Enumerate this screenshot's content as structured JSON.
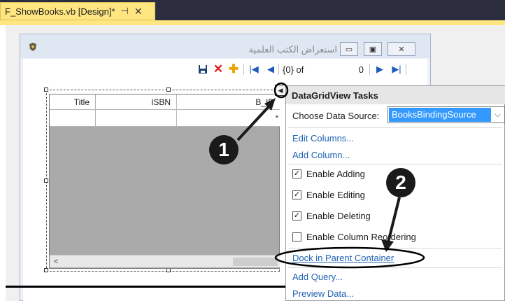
{
  "document_tab": {
    "title": "F_ShowBooks.vb [Design]*",
    "pin_icon": "pin-icon",
    "close_icon": "close-icon"
  },
  "form": {
    "title": "استعراض الكتب العلمية",
    "minimize_glyph": "▭",
    "maximize_glyph": "▣",
    "close_glyph": "✕"
  },
  "navigator": {
    "position_value": "0",
    "count_label": "{0} of"
  },
  "grid": {
    "columns": [
      "Title",
      "ISBN",
      "B_ID"
    ],
    "new_row_marker": "*",
    "scroll_left_glyph": "<"
  },
  "tasks_panel": {
    "title": "DataGridView Tasks",
    "choose_source_label": "Choose Data Source:",
    "source_value": "BooksBindingSource",
    "links": {
      "edit_columns": "Edit Columns...",
      "add_column": "Add Column...",
      "dock": "Dock in Parent Container",
      "add_query": "Add Query...",
      "preview": "Preview Data..."
    },
    "checkboxes": [
      {
        "label": "Enable Adding",
        "checked": true
      },
      {
        "label": "Enable Editing",
        "checked": true
      },
      {
        "label": "Enable Deleting",
        "checked": true
      },
      {
        "label": "Enable Column Reordering",
        "checked": false
      }
    ]
  },
  "callouts": {
    "first": "1",
    "second": "2"
  },
  "colors": {
    "tab_yellow": "#ffe680",
    "topbar": "#2d2d40",
    "selection_blue": "#3399ff",
    "link_blue": "#1f62b5"
  }
}
